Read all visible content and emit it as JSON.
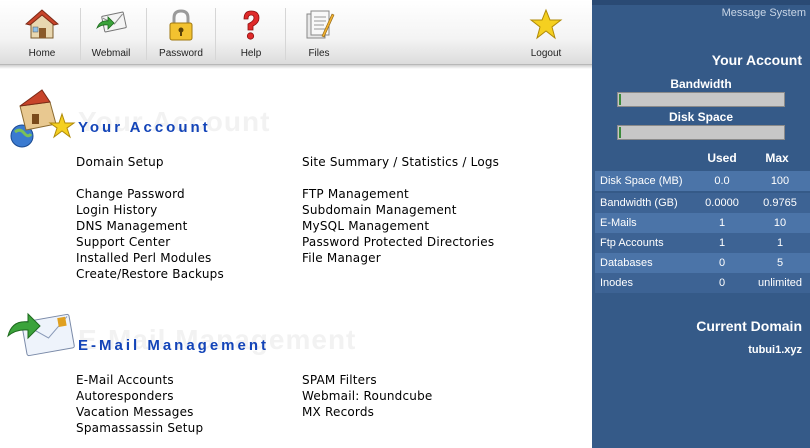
{
  "toolbar": {
    "items": [
      {
        "label": "Home",
        "icon": "home-icon"
      },
      {
        "label": "Webmail",
        "icon": "webmail-icon"
      },
      {
        "label": "Password",
        "icon": "lock-icon"
      },
      {
        "label": "Help",
        "icon": "question-icon"
      },
      {
        "label": "Files",
        "icon": "files-icon"
      }
    ],
    "logout": {
      "label": "Logout",
      "icon": "star-icon"
    }
  },
  "panel": {
    "message_system": "Message System",
    "your_account": "Your Account",
    "bandwidth_label": "Bandwidth",
    "disk_space_label": "Disk Space",
    "bandwidth_usage_fraction": 0.0,
    "disk_usage_fraction": 0.0,
    "stats_headers": {
      "used": "Used",
      "max": "Max"
    },
    "stats": [
      {
        "name": "Disk Space (MB)",
        "used": "0.0",
        "max": "100"
      },
      {
        "name": "Bandwidth (GB)",
        "used": "0.0000",
        "max": "0.9765"
      },
      {
        "name": "E-Mails",
        "used": "1",
        "max": "10"
      },
      {
        "name": "Ftp Accounts",
        "used": "1",
        "max": "1"
      },
      {
        "name": "Databases",
        "used": "0",
        "max": "5"
      },
      {
        "name": "Inodes",
        "used": "0",
        "max": "unlimited"
      }
    ],
    "current_domain_label": "Current Domain",
    "current_domain": "tubui1.xyz"
  },
  "sections": {
    "account": {
      "title": "Your Account",
      "ghost": "Your Account",
      "left_links": [
        "Domain Setup",
        "Change Password",
        "Login History",
        "DNS Management",
        "Support Center",
        "Installed Perl Modules",
        "Create/Restore Backups"
      ],
      "right_links": [
        "Site Summary / Statistics / Logs",
        "FTP Management",
        "Subdomain Management",
        "MySQL Management",
        "Password Protected Directories",
        "File Manager"
      ]
    },
    "email": {
      "title": "E-Mail Management",
      "ghost": "E-Mail Management",
      "left_links": [
        "E-Mail Accounts",
        "Autoresponders",
        "Vacation Messages",
        "Spamassassin Setup"
      ],
      "right_links": [
        "SPAM Filters",
        "Webmail: Roundcube",
        "MX Records"
      ]
    }
  },
  "colors": {
    "panel": "#355a88",
    "section_title": "#1344b8",
    "row_odd": "#4b74a8",
    "row_even": "#3d6394"
  }
}
